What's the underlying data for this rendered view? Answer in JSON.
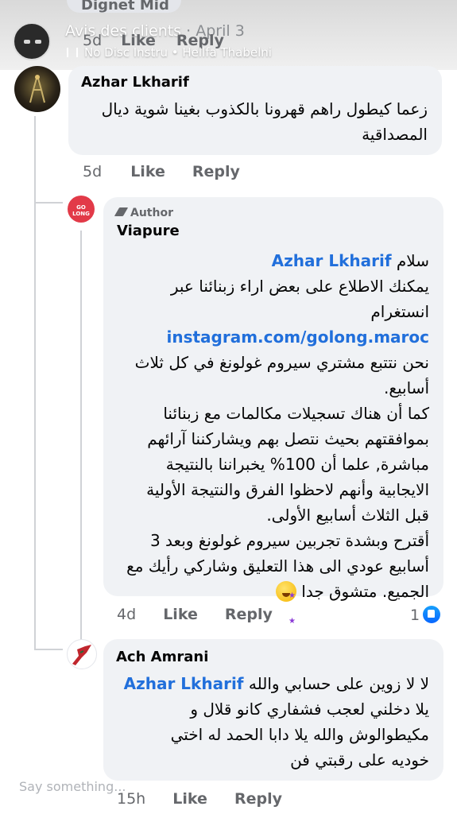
{
  "story": {
    "prev_commenter": "Dignet  Mid",
    "title": "Avis des clients",
    "date": "· April 3",
    "prev_age": "5d",
    "music": "No Disc Instru • Hellfa Thabelni"
  },
  "actions": {
    "like": "Like",
    "reply": "Reply"
  },
  "comments": [
    {
      "name": "Azhar Lkharif",
      "lines": [
        "زعما كيطول راهم قهرونا بالكذوب بغينا شوية ديال",
        "المصداقية"
      ],
      "age": "5d"
    },
    {
      "badge": "Author",
      "name": "Viapure",
      "mention": "Azhar Lkharif",
      "greeting": "سلام",
      "line1": "يمكنك الاطلاع على بعض اراء زبنائنا عبر",
      "link": "instagram.com/golong.maroc",
      "link_prefix": "انستغرام",
      "lines": [
        "نحن نتتبع مشتري سيروم غولونغ في كل ثلاث",
        "أسابيع.",
        "كما أن هناك تسجيلات مكالمات مع زبنائنا",
        "بموافقتهم بحيث نتصل بهم ويشاركننا آرائهم",
        "مباشرة, علما أن 100% يخبراننا بالنتيجة",
        "الايجابية وأنهم لاحظوا الفرق والنتيجة الأولية",
        "قبل الثلاث أسابيع الأولى.",
        "أقترح وبشدة تجربين سيروم غولونغ وبعد 3",
        "أسابيع عودي الى هذا التعليق وشاركي رأيك مع"
      ],
      "last_line": "الجميع. متشوق جدا",
      "age": "4d",
      "reactions": "1",
      "avatar_text": "GO LONG"
    },
    {
      "name": "Ach Amrani",
      "mention": "Azhar Lkharif",
      "first": "لا لا زوين على حسابي والله",
      "lines": [
        "يلا دخلني لعجب فشفاري  كانو قلال و",
        "مكيطوالوش والله يلا  دابا الحمد له اختي",
        "خوديه على رقبتي فن"
      ],
      "age": "15h"
    }
  ],
  "composer": {
    "placeholder": "Say something..."
  }
}
